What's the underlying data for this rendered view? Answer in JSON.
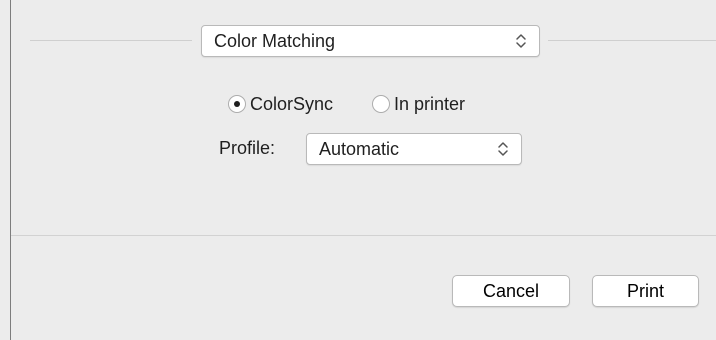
{
  "dialog": {
    "section_popup": {
      "selected": "Color Matching",
      "icon": "up-down-arrows-icon"
    },
    "color_matching": {
      "radio_options": [
        {
          "label": "ColorSync",
          "selected": true
        },
        {
          "label": "In printer",
          "selected": false
        }
      ],
      "profile_label": "Profile:",
      "profile_popup": {
        "selected": "Automatic",
        "icon": "up-down-arrows-icon"
      }
    },
    "buttons": {
      "cancel_label": "Cancel",
      "print_label": "Print"
    }
  },
  "colors": {
    "background": "#ececec",
    "control_background": "#ffffff",
    "control_border": "#b9b9b9",
    "divider": "#d2d2d2",
    "text": "#1f1f1f"
  }
}
